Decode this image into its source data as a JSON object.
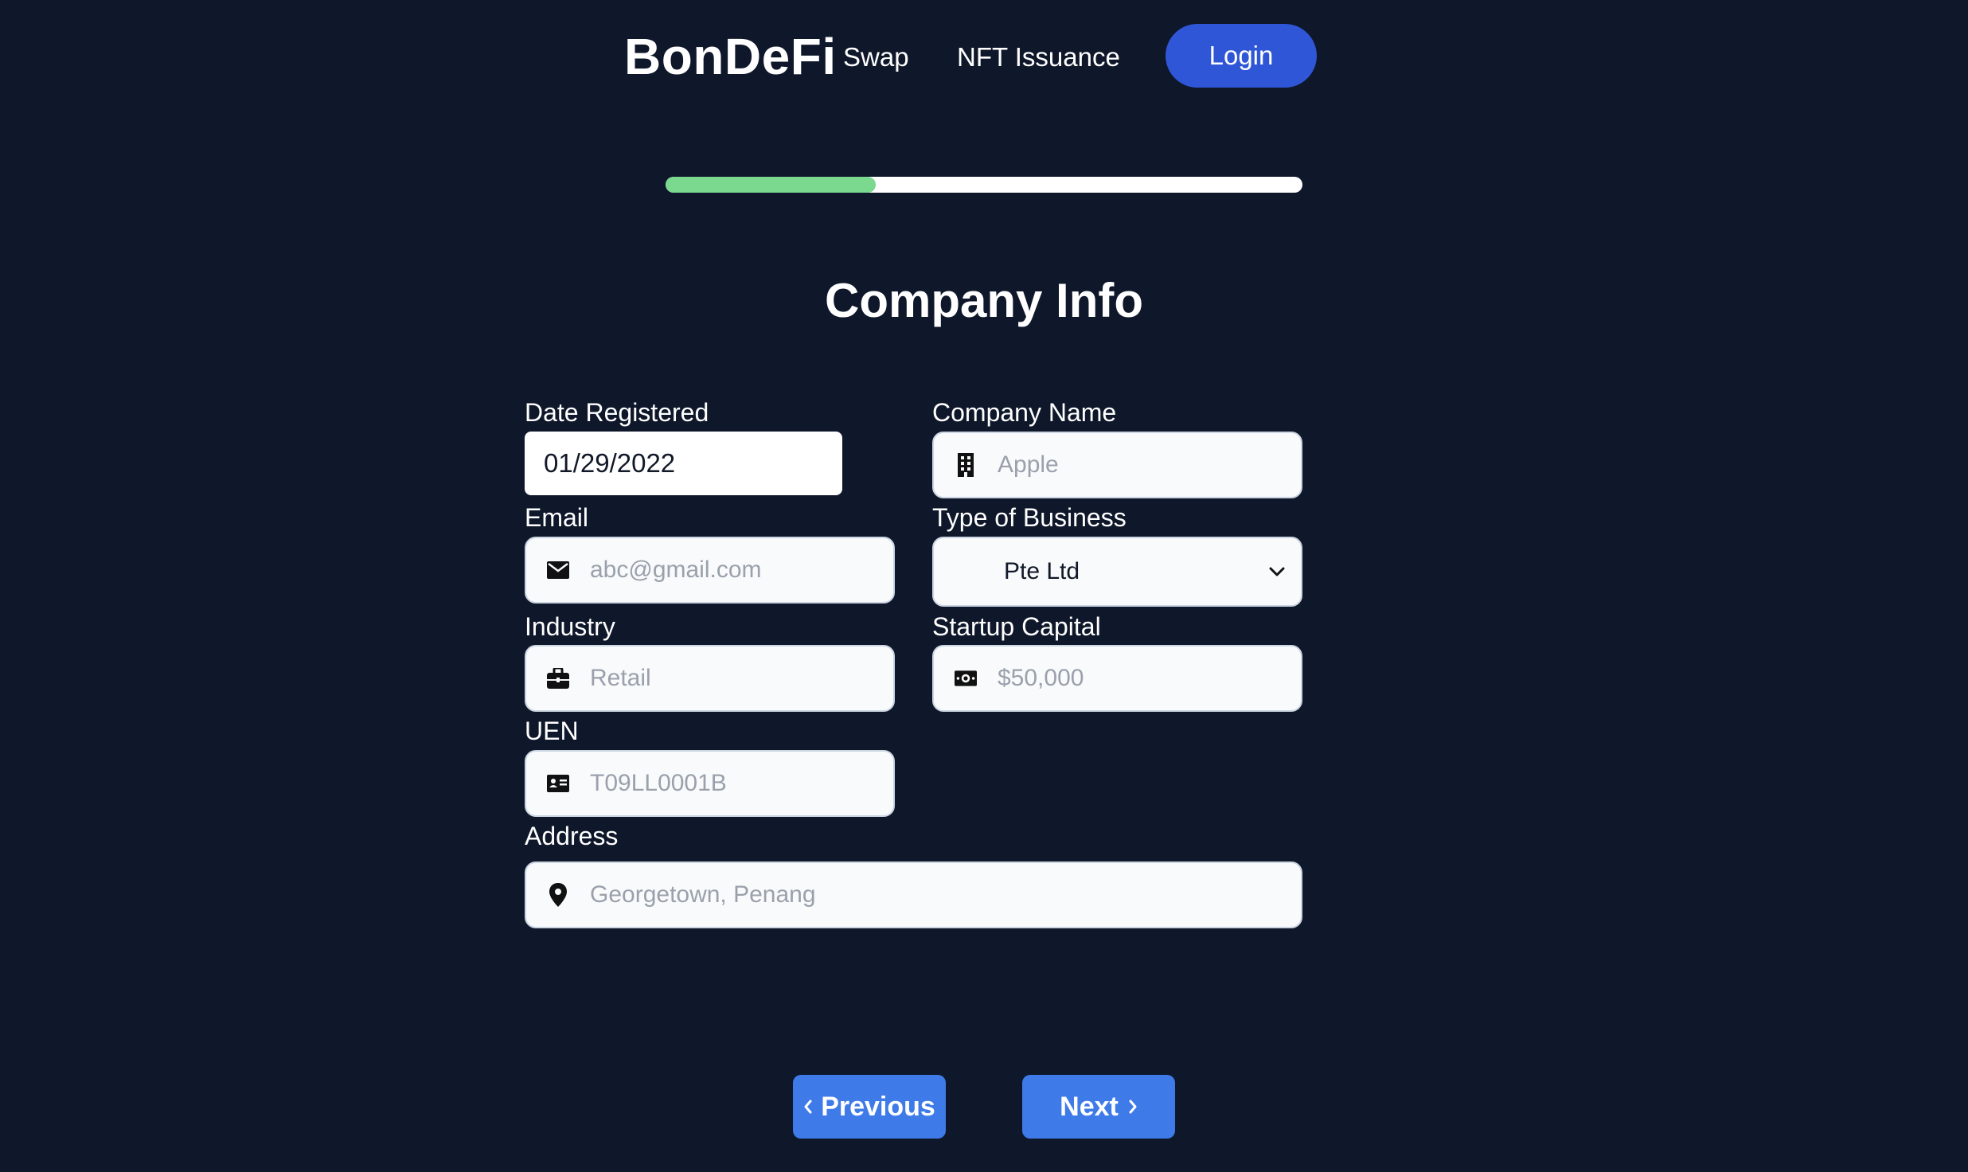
{
  "header": {
    "brand": "BonDeFi",
    "nav": [
      {
        "label": "Swap"
      },
      {
        "label": "NFT Issuance"
      }
    ],
    "login_label": "Login"
  },
  "progress": {
    "fraction": 0.33,
    "fill_color": "#7bd88f",
    "track_color": "#ffffff"
  },
  "form": {
    "title": "Company Info",
    "date_registered": {
      "label": "Date Registered",
      "value": "01/29/2022"
    },
    "company_name": {
      "label": "Company Name",
      "placeholder": "Apple",
      "icon": "building-icon"
    },
    "email": {
      "label": "Email",
      "placeholder": "abc@gmail.com",
      "icon": "mail-icon"
    },
    "type_of_business": {
      "label": "Type of Business",
      "value": "Pte Ltd"
    },
    "industry": {
      "label": "Industry",
      "placeholder": "Retail",
      "icon": "briefcase-icon"
    },
    "startup_capital": {
      "label": "Startup Capital",
      "placeholder": "$50,000",
      "icon": "money-icon"
    },
    "uen": {
      "label": "UEN",
      "placeholder": "T09LL0001B",
      "icon": "id-card-icon"
    },
    "address": {
      "label": "Address",
      "placeholder": "Georgetown, Penang",
      "icon": "location-pin-icon"
    }
  },
  "footer": {
    "previous_label": "Previous",
    "next_label": "Next"
  },
  "colors": {
    "background": "#0f172a",
    "login_button": "#2f56d6",
    "nav_buttons": "#3f7be8"
  }
}
